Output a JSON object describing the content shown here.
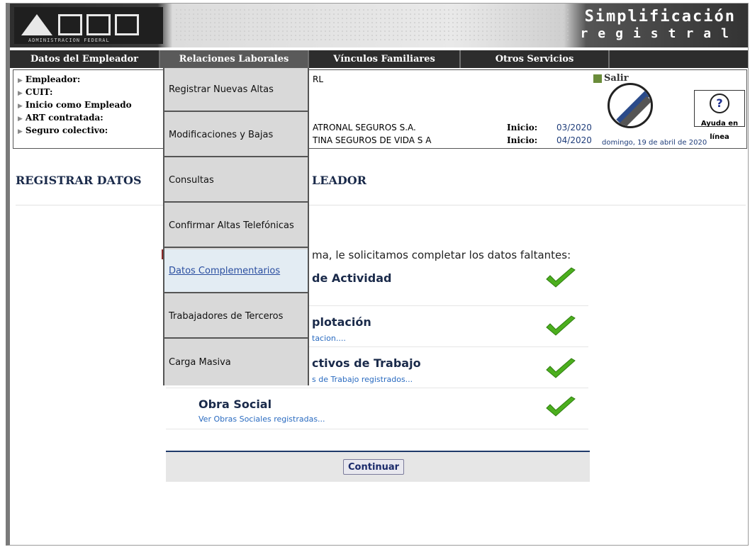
{
  "header": {
    "logo_subtitle": "ADMINISTRACION FEDERAL",
    "brand_line1": "Simplificación",
    "brand_line2": "registral"
  },
  "navbar": {
    "items": [
      {
        "label": "Datos del Empleador"
      },
      {
        "label": "Relaciones Laborales"
      },
      {
        "label": "Vínculos Familiares"
      },
      {
        "label": "Otros Servicios"
      }
    ]
  },
  "info": {
    "labels": [
      "Empleador:",
      "CUIT:",
      "Inicio como Empleado",
      "ART contratada:",
      "Seguro colectivo:"
    ],
    "empleador_val": "RL",
    "art_val": "ATRONAL SEGUROS S.A.",
    "seguro_val": "TINA SEGUROS DE VIDA S A",
    "inicio_label": "Inicio:",
    "art_inicio": "03/2020",
    "seguro_inicio": "04/2020",
    "date": "domingo, 19 de abril de 2020",
    "salir": "Salir",
    "help": "Ayuda en línea"
  },
  "main": {
    "title_left": "REGISTRAR DATOS",
    "title_right": "LEADOR",
    "prompt": "ma, le solicitamos completar los datos faltantes:",
    "sections": [
      {
        "title": "de Actividad",
        "link": ""
      },
      {
        "title": "plotación",
        "link": "tacion...."
      },
      {
        "title": "ctivos de Trabajo",
        "link": "s de Trabajo registrados..."
      },
      {
        "title": "Obra Social",
        "link": "Ver Obras Sociales registradas..."
      }
    ],
    "continue_label": "Continuar"
  },
  "dropdown": {
    "items": [
      {
        "label": "Registrar Nuevas Altas"
      },
      {
        "label": "Modificaciones y Bajas"
      },
      {
        "label": "Consultas"
      },
      {
        "label": "Confirmar Altas Telefónicas"
      },
      {
        "label": "Datos Complementarios"
      },
      {
        "label": "Trabajadores de Terceros"
      },
      {
        "label": "Carga Masiva"
      }
    ]
  },
  "colors": {
    "nav_bg": "#2d2d2d",
    "check": "#4caf1e",
    "link": "#2a6bc0"
  }
}
